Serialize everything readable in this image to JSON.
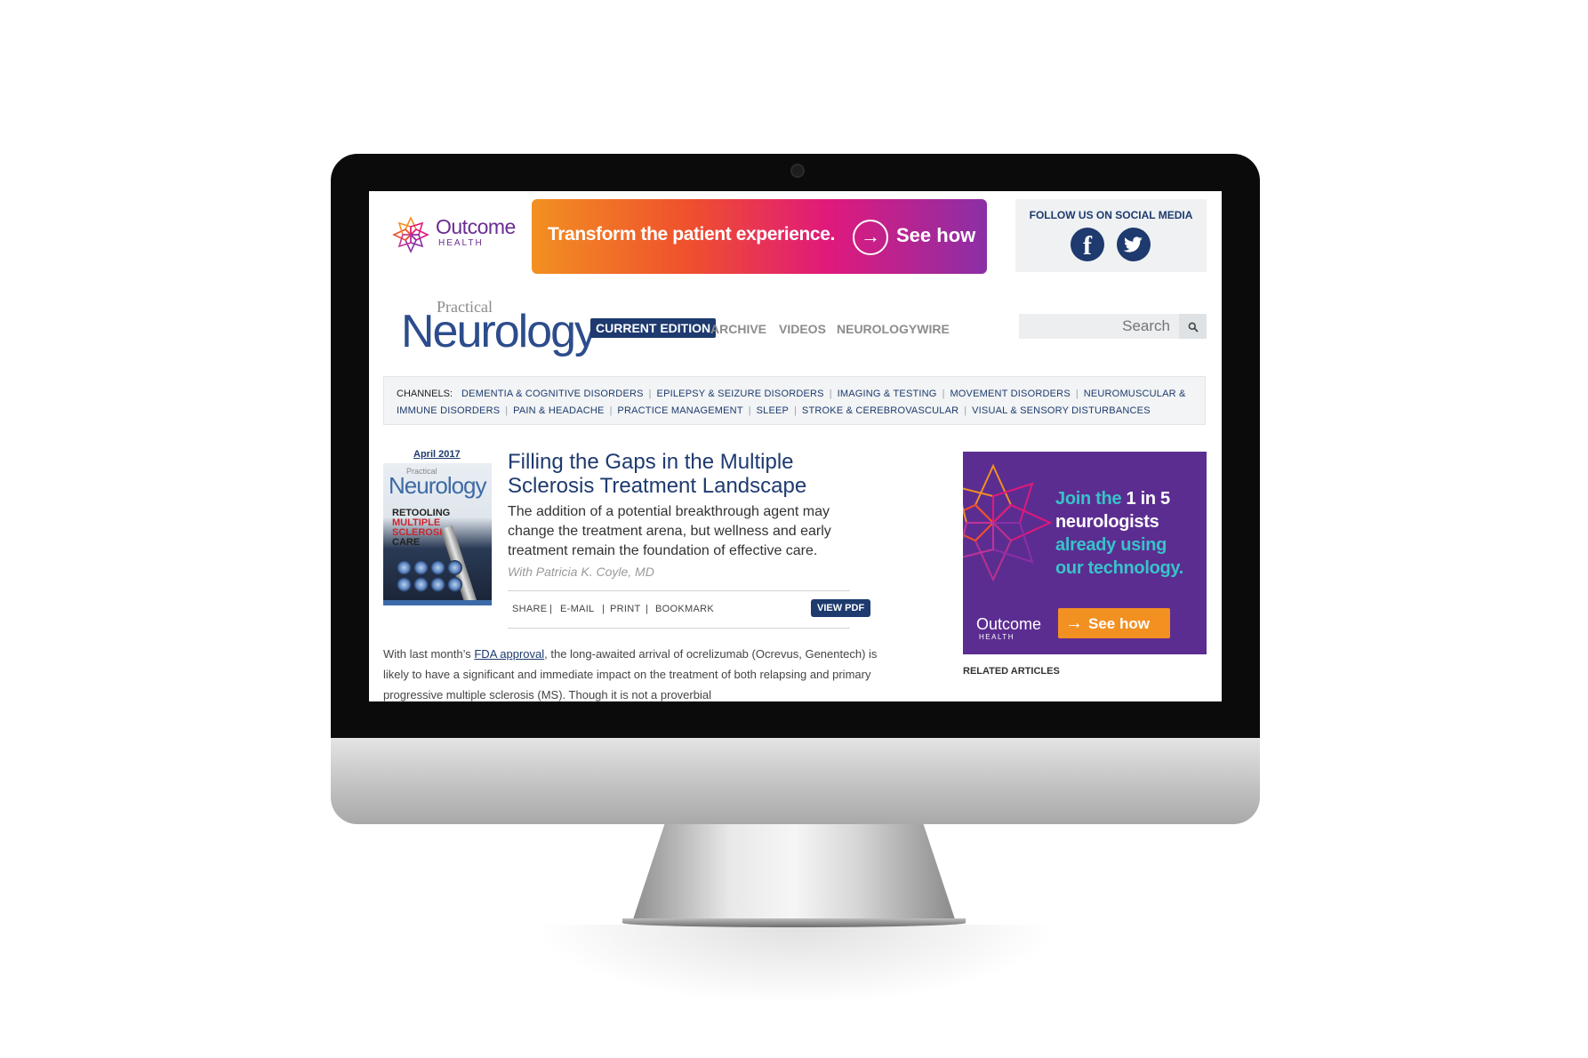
{
  "top_ad": {
    "brand": "Outcome",
    "brand_sub": "HEALTH",
    "banner_text": "Transform the patient experience.",
    "banner_cta": "See how"
  },
  "social": {
    "label": "FOLLOW US ON SOCIAL MEDIA",
    "facebook_glyph": "f",
    "icons": [
      "facebook-icon",
      "twitter-icon"
    ]
  },
  "masthead": {
    "brand_small": "Practical",
    "brand_large": "Neurology"
  },
  "nav": {
    "current": "CURRENT EDITION",
    "archive": "ARCHIVE",
    "videos": "VIDEOS",
    "wire": "NEUROLOGYWIRE"
  },
  "search": {
    "placeholder": "Search",
    "icon": "search-icon"
  },
  "channels": {
    "label": "CHANNELS:",
    "items": [
      "DEMENTIA & COGNITIVE DISORDERS",
      "EPILEPSY & SEIZURE DISORDERS",
      "IMAGING & TESTING",
      "MOVEMENT DISORDERS",
      "NEUROMUSCULAR & IMMUNE DISORDERS",
      "PAIN & HEADACHE",
      "PRACTICE MANAGEMENT",
      "SLEEP",
      "STROKE & CEREBROVASCULAR",
      "VISUAL & SENSORY DISTURBANCES"
    ]
  },
  "article": {
    "issue_date": "April 2017",
    "cover": {
      "brand_small": "Practical",
      "brand_large": "Neurology",
      "headline_lines": [
        "RETOOLING",
        "MULTIPLE",
        "SCLEROSIS",
        "CARE"
      ]
    },
    "title": "Filling the Gaps in the Multiple Sclerosis Treatment Landscape",
    "dek": "The addition of a potential breakthrough agent may change the treatment arena, but wellness and early treatment remain the foundation of effective care.",
    "byline": "With Patricia K. Coyle, MD",
    "tools": {
      "share": "SHARE",
      "email": "E-MAIL",
      "print": "PRINT",
      "bookmark": "BOOKMARK",
      "separator": "|"
    },
    "view_pdf": "VIEW PDF",
    "body": {
      "before_link": "With last month’s ",
      "link": "FDA approval",
      "after_link": ", the long-awaited arrival of ocrelizumab (Ocrevus, Genentech) is likely to have a significant and immediate impact on the treatment of both relapsing and primary progressive multiple sclerosis (MS). Though it is not a proverbial"
    }
  },
  "side_ad": {
    "line_1a": "Join the ",
    "line_1b": "1 in 5",
    "line_2": "neurologists",
    "line_3": "already using our technology.",
    "brand": "Outcome",
    "brand_sub": "HEALTH",
    "cta": "See how",
    "colors": {
      "background": "#5c2d91",
      "teal": "#38c3c9",
      "cta": "#f29022"
    }
  },
  "related": {
    "heading": "RELATED ARTICLES"
  },
  "colors": {
    "brand_navy": "#1e3a6e",
    "outcome_purple": "#6a2c91"
  }
}
